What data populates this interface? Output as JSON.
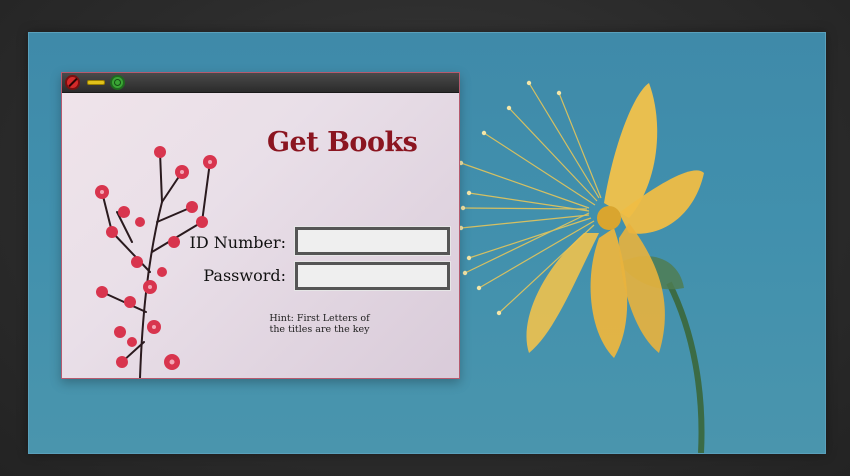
{
  "desktop": {
    "window_controls": {
      "close_icon": "close-icon",
      "minimize_icon": "minimize-icon",
      "maximize_icon": "maximize-icon"
    }
  },
  "login": {
    "title": "Get Books",
    "id_label": "ID Number:",
    "id_value": "",
    "password_label": "Password:",
    "password_value": "",
    "hint_line1": "Hint: First Letters of",
    "hint_line2": "the titles are the key"
  },
  "colors": {
    "title": "#8b1520",
    "wallpaper": "#4190ad",
    "titlebar": "#2b2b2b",
    "close_button": "#d42a2a",
    "minimize_button": "#e1c21b",
    "maximize_button": "#3aa535"
  }
}
